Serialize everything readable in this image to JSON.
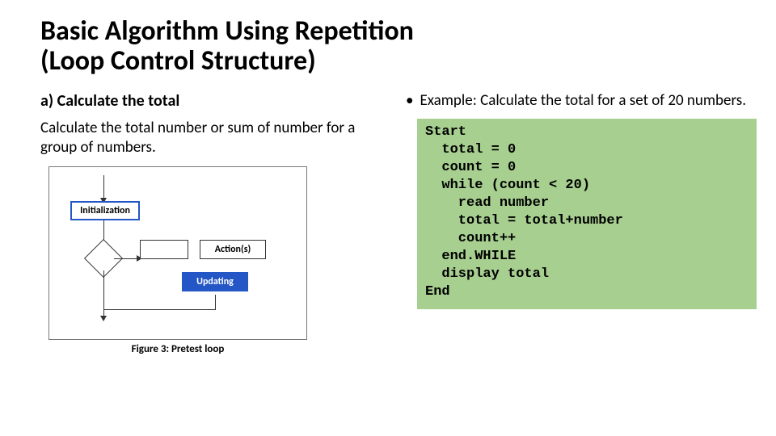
{
  "title_l1": "Basic Algorithm Using Repetition",
  "title_l2": "(Loop Control Structure)",
  "left": {
    "item_label": "a)   Calculate the total",
    "desc": "Calculate the total number or sum of number for a group of numbers.",
    "fig": {
      "box_init": "Initialization",
      "box_actions": "Action(s)",
      "box_updating": "Updating",
      "caption": "Figure 3: Pretest loop"
    }
  },
  "right": {
    "bullet": "Example: Calculate the total for a set of 20 numbers.",
    "code": "Start\n  total = 0\n  count = 0\n  while (count < 20)\n    read number\n    total = total+number\n    count++\n  end.WHILE\n  display total\nEnd"
  }
}
